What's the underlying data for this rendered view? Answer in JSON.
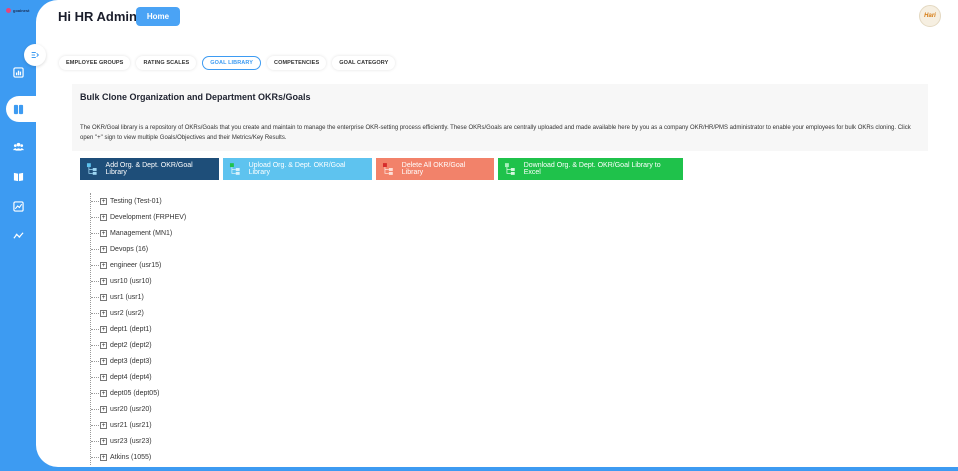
{
  "brand": {
    "name": "goalnest"
  },
  "header": {
    "greeting": "Hi HR Admin",
    "home_label": "Home",
    "avatar_text": "Hari"
  },
  "sidebar": {
    "collapse_icon": "expand-icon",
    "items": [
      {
        "icon": "dashboard-icon"
      },
      {
        "icon": "apps-icon",
        "active": true
      },
      {
        "icon": "users-icon"
      },
      {
        "icon": "book-icon"
      },
      {
        "icon": "report-icon"
      },
      {
        "icon": "analytics-icon"
      }
    ]
  },
  "tabs": [
    {
      "label": "EMPLOYEE GROUPS"
    },
    {
      "label": "RATING SCALES"
    },
    {
      "label": "GOAL LIBRARY",
      "active": true
    },
    {
      "label": "COMPETENCIES"
    },
    {
      "label": "GOAL CATEGORY"
    }
  ],
  "panel": {
    "title": "Bulk Clone Organization and Department OKRs/Goals",
    "description": "The OKR/Goal library is a repository of OKRs/Goals that you create and maintain to manage the enterprise OKR-setting process efficiently. These OKRs/Goals are centrally uploaded and made available here by you as a company OKR/HR/PMS administrator to enable your employees for bulk OKRs cloning. Click open \"+\" sign to view multiple Goals/Objectives and their Metrics/Key Results."
  },
  "actions": {
    "add": "Add Org. & Dept. OKR/Goal Library",
    "upload": "Upload Org. & Dept. OKR/Goal Library",
    "delete": "Delete All OKR/Goal Library",
    "download": "Download Org. & Dept. OKR/Goal Library to Excel"
  },
  "colors": {
    "accent": "#3d9bf2",
    "add": "#1e4e79",
    "upload": "#5ec3ef",
    "delete": "#f2826a",
    "download": "#1fc24b"
  },
  "tree": {
    "expander": "+",
    "items": [
      "Testing (Test-01)",
      "Development (FRPHEV)",
      "Management (MN1)",
      "Devops (16)",
      "engineer (usr15)",
      "usr10 (usr10)",
      "usr1 (usr1)",
      "usr2 (usr2)",
      "dept1 (dept1)",
      "dept2 (dept2)",
      "dept3 (dept3)",
      "dept4 (dept4)",
      "dept05 (dept05)",
      "usr20 (usr20)",
      "usr21 (usr21)",
      "usr23 (usr23)",
      "Atkins (1055)"
    ]
  }
}
